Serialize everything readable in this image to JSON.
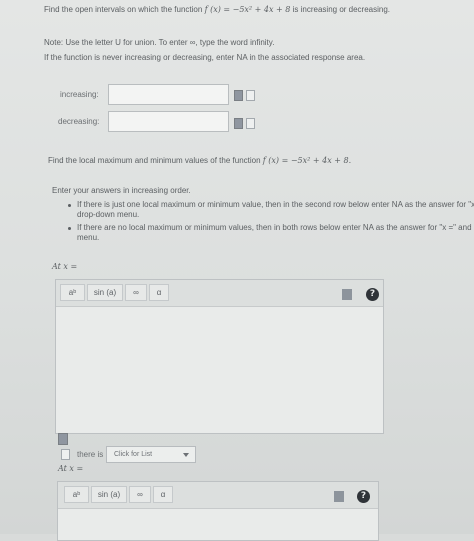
{
  "question": {
    "prompt_pre": "Find the open intervals on which the function",
    "function": "f (x) = −5x² + 4x + 8",
    "prompt_post": "is increasing or decreasing.",
    "note": "Note: Use the letter U for union. To enter ∞, type the word infinity.",
    "never_note": "If the function is never increasing or decreasing, enter NA in the associated response area."
  },
  "answers": {
    "increasing_label": "increasing:",
    "decreasing_label": "decreasing:",
    "increasing_value": "",
    "decreasing_value": ""
  },
  "extrema": {
    "prompt_pre": "Find the local maximum and minimum values of the function",
    "function": "f (x) = −5x² + 4x + 8.",
    "order_text": "Enter your answers in increasing order.",
    "bullet1_line1": "If there is just one local maximum or minimum value, then in the second row below enter NA as the answer for \"x",
    "bullet1_line2": "drop-down menu.",
    "bullet2_line1": "If there are no local maximum or minimum values, then in both rows below enter NA as the answer for \"x =\" and",
    "bullet2_line2": "menu.",
    "row1_label": "At x =",
    "row2_label": "At x ="
  },
  "toolbar": {
    "power": "aᵇ",
    "sin": "sin (a)",
    "infinity": "∞",
    "alpha": "α",
    "help": "?"
  },
  "row1": {
    "there_is_label": "there is",
    "select_value": "Click for List"
  },
  "icons": {
    "submit": "submit-answer-icon",
    "preview": "preview-icon",
    "trash": "trash-icon",
    "help": "help-icon"
  }
}
